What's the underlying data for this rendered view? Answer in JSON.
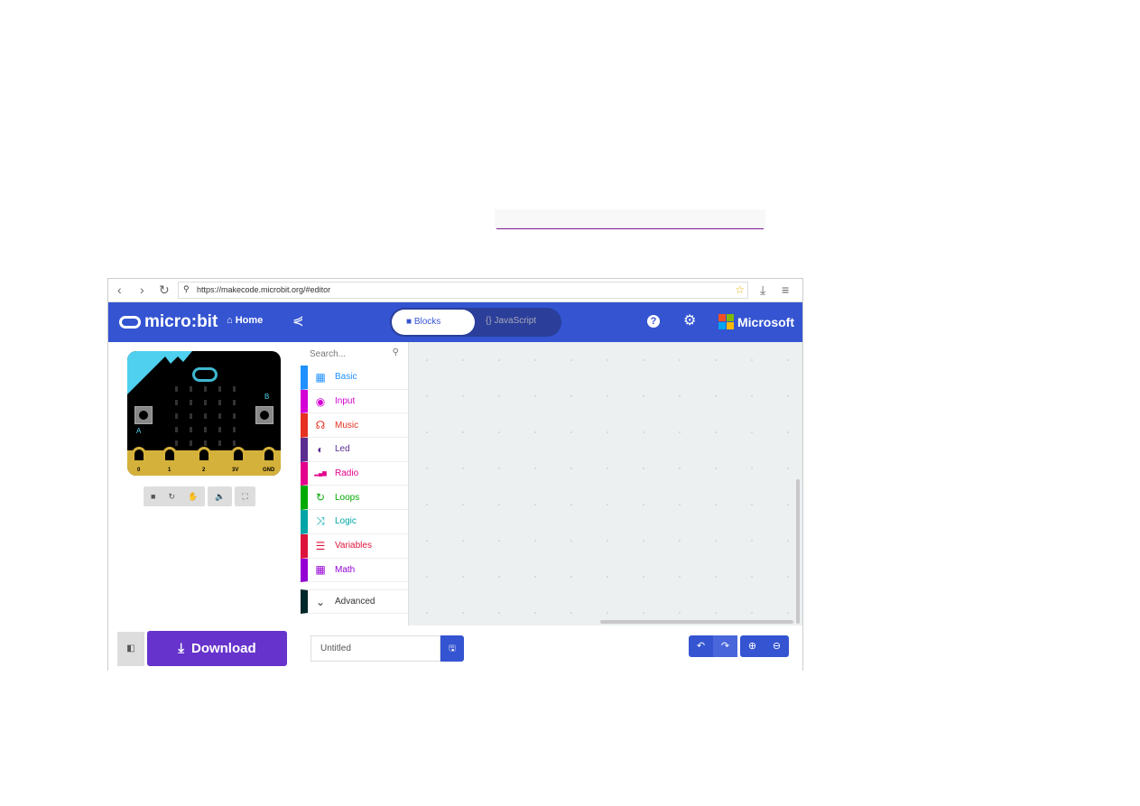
{
  "browser": {
    "url": "https://makecode.microbit.org/#editor",
    "back": "‹",
    "forward": "›",
    "reload": "↻"
  },
  "header": {
    "logo": "micro:bit",
    "home": "Home",
    "tabs": {
      "blocks": "Blocks",
      "javascript": "{} JavaScript"
    },
    "help": "?",
    "brand": "Microsoft",
    "accent": "#3454d1"
  },
  "simulator": {
    "pins": [
      "0",
      "1",
      "2",
      "3V",
      "GND"
    ],
    "buttons": [
      "A",
      "B"
    ]
  },
  "toolbox": {
    "search_placeholder": "Search...",
    "categories": [
      {
        "label": "Basic",
        "color": "#1e90ff",
        "icon": "grid-icon"
      },
      {
        "label": "Input",
        "color": "#d400d4",
        "icon": "target-icon"
      },
      {
        "label": "Music",
        "color": "#e63022",
        "icon": "headphones-icon"
      },
      {
        "label": "Led",
        "color": "#5c2d91",
        "icon": "toggle-icon"
      },
      {
        "label": "Radio",
        "color": "#e3008c",
        "icon": "signal-icon"
      },
      {
        "label": "Loops",
        "color": "#00aa00",
        "icon": "loop-icon"
      },
      {
        "label": "Logic",
        "color": "#00a4a6",
        "icon": "shuffle-icon"
      },
      {
        "label": "Variables",
        "color": "#dc143c",
        "icon": "list-icon"
      },
      {
        "label": "Math",
        "color": "#9400d3",
        "icon": "calculator-icon"
      }
    ],
    "advanced": {
      "label": "Advanced",
      "color": "#00272b"
    }
  },
  "footer": {
    "download": "Download",
    "project_name": "Untitled",
    "download_color": "#6633cc"
  }
}
